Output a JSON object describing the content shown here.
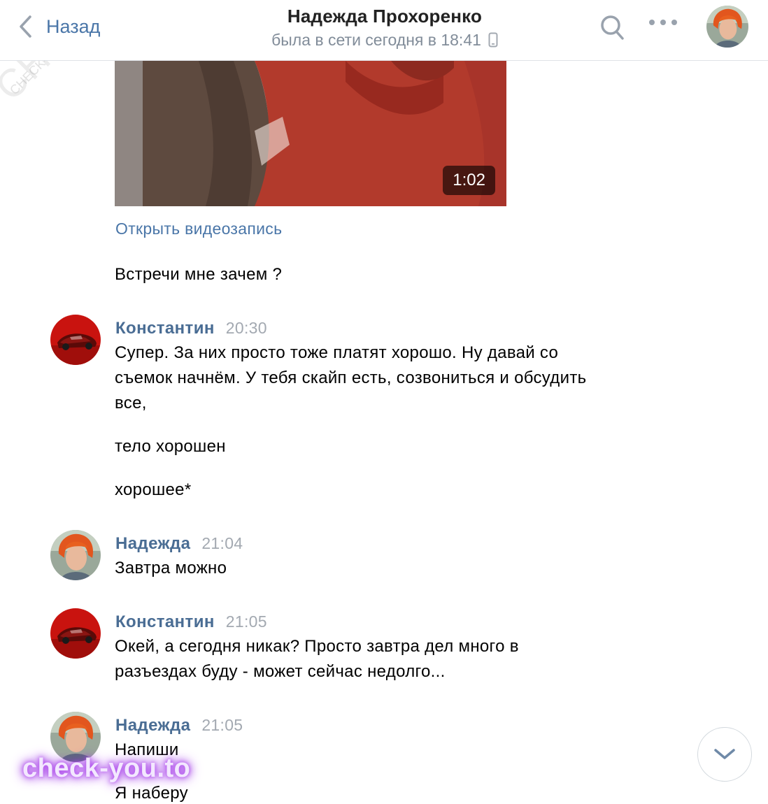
{
  "header": {
    "back_label": "Назад",
    "title": "Надежда Прохоренко",
    "status": "была в сети сегодня в 18:41"
  },
  "video": {
    "duration": "1:02",
    "open_link": "Открыть видеозапись"
  },
  "messages": [
    {
      "kind": "text",
      "text": "Встречи мне зачем ?"
    },
    {
      "kind": "group",
      "author": "Константин",
      "time": "20:30",
      "lines": [
        "Супер. За них просто тоже платят хорошо. Ну давай со",
        "съемок начнём. У тебя скайп есть, созвониться и обсудить",
        "все,"
      ]
    },
    {
      "kind": "text",
      "text": "тело хорошен"
    },
    {
      "kind": "text",
      "text": "хорошее*"
    },
    {
      "kind": "group",
      "author": "Надежда",
      "time": "21:04",
      "lines": [
        "Завтра можно"
      ]
    },
    {
      "kind": "group",
      "author": "Константин",
      "time": "21:05",
      "lines": [
        "Окей, а сегодня никак? Просто завтра дел много в",
        "разъездах буду - может сейчас недолго..."
      ]
    },
    {
      "kind": "group",
      "author": "Надежда",
      "time": "21:05",
      "lines": [
        "Напиши"
      ]
    },
    {
      "kind": "text",
      "text": "Я наберу"
    }
  ],
  "icons": {
    "back": "chevron-left-icon",
    "search": "search-icon",
    "more": "more-horizontal-icon",
    "mobile": "mobile-phone-icon",
    "scroll": "chevron-down-icon"
  },
  "colors": {
    "accent": "#4a76a8",
    "author": "#4a6d94",
    "secondary": "#818c99"
  },
  "watermarks": {
    "diagonal": "CHECK-YOU.ME",
    "diagonal_small": "CHECK-YOU.ME",
    "logo": "check-you.to"
  }
}
